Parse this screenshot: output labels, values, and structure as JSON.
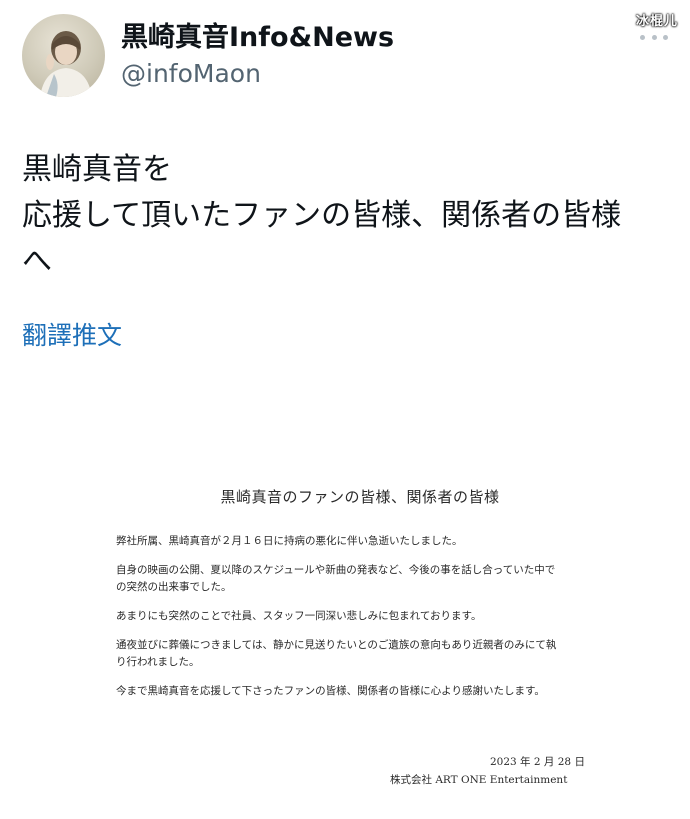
{
  "watermark": "冰棍儿",
  "profile": {
    "display_name": "黒崎真音Info&News",
    "handle": "@infoMaon"
  },
  "tweet": {
    "lines": [
      "黒崎真音を",
      "応援して頂いたファンの皆様、関係者の皆様",
      "へ"
    ],
    "translate_label": "翻譯推文"
  },
  "letter": {
    "title": "黒崎真音のファンの皆様、関係者の皆様",
    "paragraphs": [
      [
        "弊社所属、黒崎真音が２月１６日に持病の悪化に伴い急逝いたしました。"
      ],
      [
        "自身の映画の公開、夏以降のスケジュールや新曲の発表など、今後の事を話し合っていた中で",
        "の突然の出来事でした。"
      ],
      [
        "あまりにも突然のことで社員、スタッフ一同深い悲しみに包まれております。"
      ],
      [
        "通夜並びに葬儀につきましては、静かに見送りたいとのご遺族の意向もあり近親者のみにて執",
        "り行われました。"
      ],
      [
        "今まで黒崎真音を応援して下さったファンの皆様、関係者の皆様に心より感謝いたします。"
      ]
    ],
    "date": "2023 年 2 月 28 日",
    "company": "株式会社  ART ONE Entertainment"
  },
  "colors": {
    "link": "#1d6fb8",
    "handle": "#536471",
    "text": "#0f1419"
  }
}
